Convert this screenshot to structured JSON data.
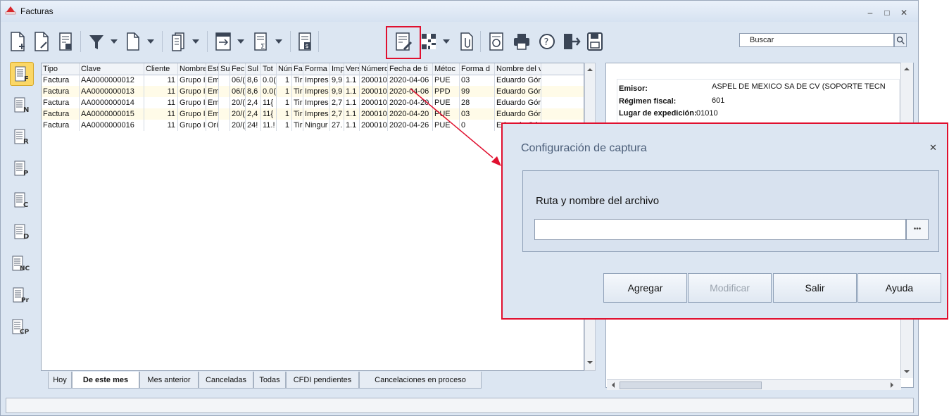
{
  "window": {
    "title": "Facturas",
    "controls": {
      "minimize": "–",
      "maximize": "□",
      "close": "✕"
    }
  },
  "toolbar": {
    "search_placeholder": "Buscar",
    "icons": [
      "new-document-icon",
      "edit-document-icon",
      "delete-document-icon",
      "filter-icon",
      "copy-document-icon",
      "pages-icon",
      "export-icon",
      "summary-icon",
      "invoice-amount-icon",
      "capture-config-icon",
      "qr-code-icon",
      "attach-document-icon",
      "stamp-icon",
      "print-icon",
      "help-icon",
      "exit-icon",
      "save-icon"
    ]
  },
  "sidebar": {
    "items": [
      {
        "label": "F",
        "icon": "invoice-f-icon",
        "active": true
      },
      {
        "label": "N",
        "icon": "invoice-n-icon"
      },
      {
        "label": "R",
        "icon": "invoice-r-icon"
      },
      {
        "label": "P",
        "icon": "invoice-p-icon"
      },
      {
        "label": "C",
        "icon": "invoice-c-icon"
      },
      {
        "label": "D",
        "icon": "invoice-d-icon"
      },
      {
        "label": "NC",
        "icon": "invoice-nc-icon"
      },
      {
        "label": "Pr",
        "icon": "invoice-pr-icon"
      },
      {
        "label": "CP",
        "icon": "invoice-cp-icon"
      }
    ]
  },
  "grid": {
    "columns": [
      "Tipo",
      "Clave",
      "Cliente",
      "Nombre",
      "Est",
      "Su",
      "Fech",
      "Sul",
      "Tot",
      "Núm",
      "Fac",
      "Forma",
      "Imp",
      "Vers",
      "Número",
      "Fecha de ti",
      "Métoc",
      "Forma d",
      "Nombre del v"
    ],
    "rows": [
      [
        "Factura",
        "AA0000000012",
        "11",
        "Grupo Ir",
        "Em",
        "",
        "06/(",
        "8,6",
        "0.0(",
        "1",
        "Tir",
        "Impres",
        "9,9",
        "1.1",
        "200010",
        "2020-04-06",
        "PUE",
        "03",
        "Eduardo Gór"
      ],
      [
        "Factura",
        "AA0000000013",
        "11",
        "Grupo Ir",
        "Em",
        "",
        "06/(",
        "8,6",
        "0.0(",
        "1",
        "Tir",
        "Impres",
        "9,9",
        "1.1",
        "200010",
        "2020-04-06",
        "PPD",
        "99",
        "Eduardo Gór"
      ],
      [
        "Factura",
        "AA0000000014",
        "11",
        "Grupo Ir",
        "Em",
        "",
        "20/(",
        "2,4",
        "11{",
        "1",
        "Tir",
        "Impres",
        "2,7",
        "1.1",
        "200010",
        "2020-04-20",
        "PUE",
        "28",
        "Eduardo Gór"
      ],
      [
        "Factura",
        "AA0000000015",
        "11",
        "Grupo Ir",
        "Em",
        "",
        "20/(",
        "2,4",
        "11{",
        "1",
        "Tir",
        "Impres",
        "2,7",
        "1.1",
        "200010",
        "2020-04-20",
        "PUE",
        "03",
        "Eduardo Gór"
      ],
      [
        "Factura",
        "AA0000000016",
        "11",
        "Grupo Ir",
        "Ori",
        "",
        "20/(",
        "24!",
        "11.!",
        "1",
        "Tir",
        "Ningur",
        "27.",
        "1.1",
        "200010",
        "2020-04-26",
        "PUE",
        "0",
        "Eduardo Gór"
      ]
    ]
  },
  "tabs": [
    "Hoy",
    "De este mes",
    "Mes anterior",
    "Canceladas",
    "Todas",
    "CFDI pendientes",
    "Cancelaciones en proceso"
  ],
  "detail": {
    "emisor_label": "Emisor:",
    "emisor_value": "ASPEL DE MEXICO SA DE CV (SOPORTE TECN",
    "regimen_label": "Régimen fiscal:",
    "regimen_value": "601",
    "lugar_label": "Lugar de expedición:",
    "lugar_value": "01010"
  },
  "dialog": {
    "title": "Configuración de captura",
    "close": "✕",
    "field_label": "Ruta y nombre del archivo",
    "field_value": "",
    "browse_label": "•••",
    "buttons": {
      "add": "Agregar",
      "modify": "Modificar",
      "exit": "Salir",
      "help": "Ayuda"
    }
  },
  "colors": {
    "highlight": "#e0102f",
    "active_tab": "#ffffff",
    "selected_sidebar": "#fbd766"
  }
}
